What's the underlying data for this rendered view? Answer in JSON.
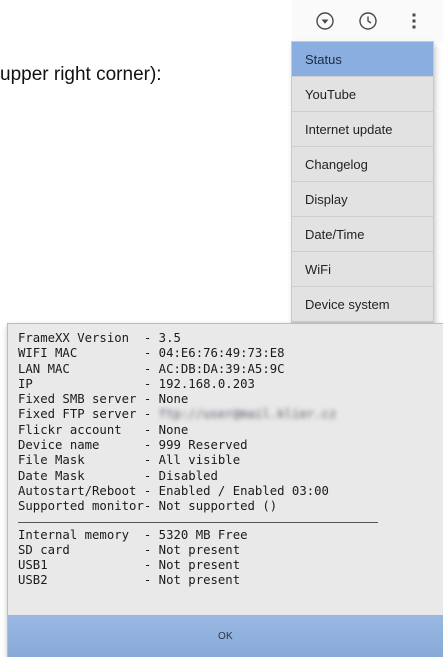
{
  "doc": {
    "text": "upper right corner):"
  },
  "icons": [
    "filter-circle-icon",
    "clock-icon",
    "more-vert-icon"
  ],
  "menu": {
    "items": [
      {
        "label": "Status",
        "active": true
      },
      {
        "label": "YouTube"
      },
      {
        "label": "Internet update"
      },
      {
        "label": "Changelog"
      },
      {
        "label": "Display"
      },
      {
        "label": "Date/Time"
      },
      {
        "label": "WiFi"
      },
      {
        "label": "Device system"
      }
    ]
  },
  "dialog": {
    "rows": [
      {
        "key": "FrameXX Version",
        "sep": "- ",
        "value": "3.5"
      },
      {
        "key": "WIFI MAC",
        "sep": "- ",
        "value": "04:E6:76:49:73:E8"
      },
      {
        "key": "LAN MAC",
        "sep": "- ",
        "value": "AC:DB:DA:39:A5:9C"
      },
      {
        "key": "IP",
        "sep": "- ",
        "value": "192.168.0.203"
      },
      {
        "key": "Fixed SMB server",
        "sep": "- ",
        "value": "None"
      },
      {
        "key": "Fixed FTP server",
        "sep": "- ",
        "value": "ftp://user@mail.klier.cz",
        "blurred": true
      },
      {
        "key": "Flickr account",
        "sep": "- ",
        "value": "None"
      },
      {
        "key": "Device name",
        "sep": "- ",
        "value": "999 Reserved"
      },
      {
        "key": "File Mask",
        "sep": "- ",
        "value": "All visible"
      },
      {
        "key": "Date Mask",
        "sep": "- ",
        "value": "Disabled"
      },
      {
        "key": "Autostart/Reboot",
        "sep": "- ",
        "value": "Enabled / Enabled 03:00"
      },
      {
        "key": "Supported monitor",
        "sep": "- ",
        "value": "Not supported ()"
      }
    ],
    "storage_rows": [
      {
        "key": "Internal memory",
        "sep": "- ",
        "value": "5320 MB Free"
      },
      {
        "key": "SD card",
        "sep": "- ",
        "value": "Not present"
      },
      {
        "key": "USB1",
        "sep": "- ",
        "value": "Not present"
      },
      {
        "key": "USB2",
        "sep": "- ",
        "value": "Not present"
      }
    ],
    "ok_label": "OK"
  },
  "colors": {
    "menu_active": "#8aaee0",
    "menu_bg": "#e2e2e2",
    "dialog_bg": "#e9e9e9",
    "ok_bar": "#8fb0dd"
  }
}
